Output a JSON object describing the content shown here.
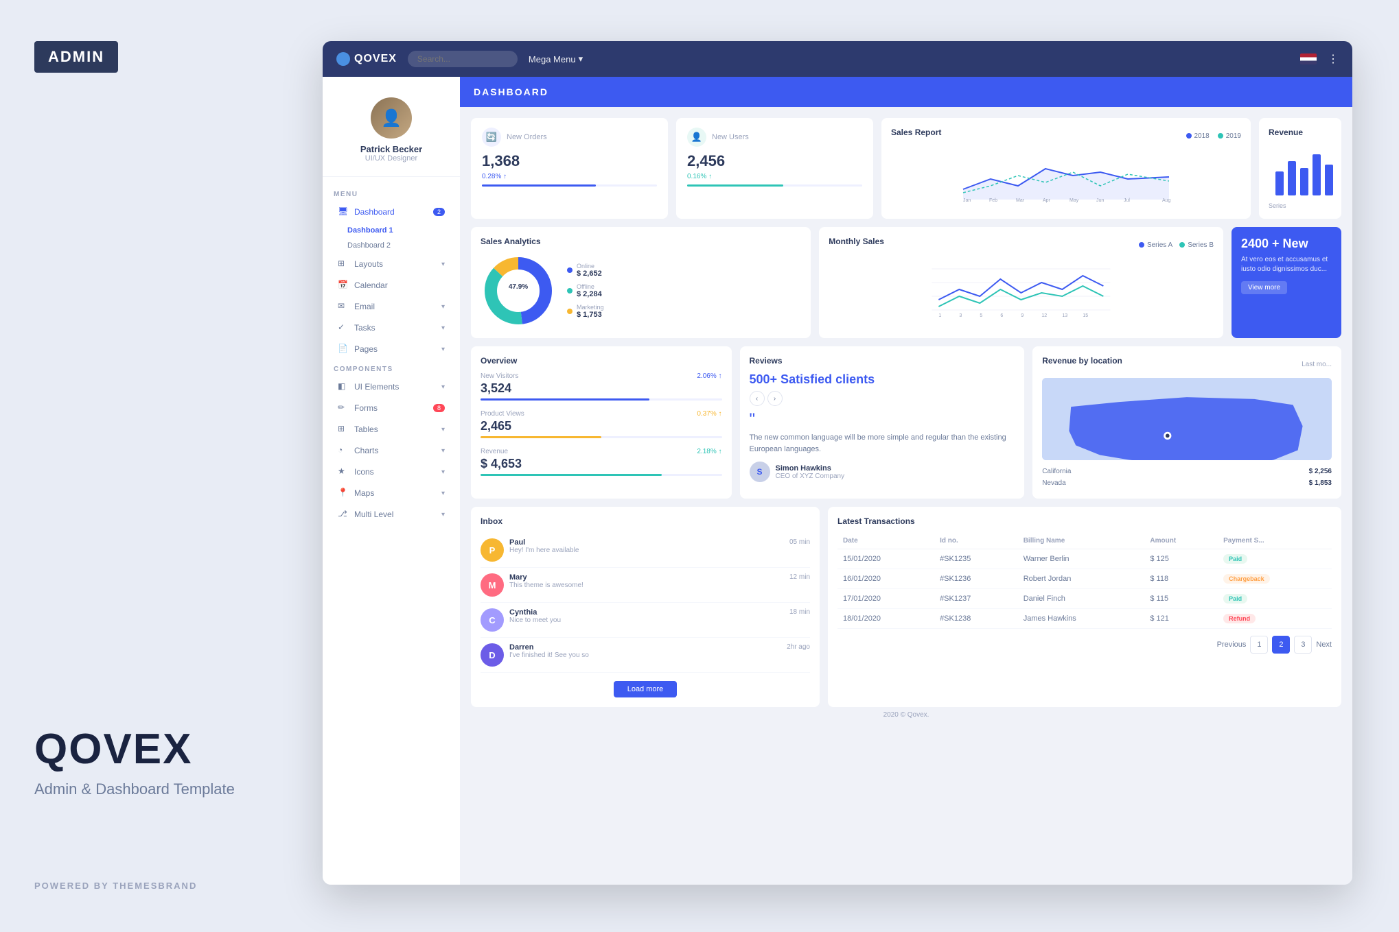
{
  "brand": {
    "admin_badge": "ADMIN",
    "title": "QOVEX",
    "subtitle": "Admin & Dashboard Template",
    "powered_by": "POWERED BY THEMESBRAND"
  },
  "navbar": {
    "logo": "QOVEX",
    "search_placeholder": "Search...",
    "mega_menu": "Mega Menu",
    "flag": "us"
  },
  "sidebar": {
    "profile": {
      "name": "Patrick Becker",
      "role": "UI/UX Designer"
    },
    "menu_label": "MENU",
    "components_label": "COMPONENTS",
    "items": [
      {
        "id": "dashboard",
        "label": "Dashboard",
        "icon": "monitor",
        "badge": "2",
        "active": true
      },
      {
        "id": "dashboard1",
        "label": "Dashboard 1",
        "sub": true
      },
      {
        "id": "dashboard2",
        "label": "Dashboard 2",
        "sub": true
      },
      {
        "id": "layouts",
        "label": "Layouts",
        "icon": "grid",
        "arrow": true
      },
      {
        "id": "calendar",
        "label": "Calendar",
        "icon": "calendar"
      },
      {
        "id": "email",
        "label": "Email",
        "icon": "mail",
        "arrow": true
      },
      {
        "id": "tasks",
        "label": "Tasks",
        "icon": "check",
        "arrow": true
      },
      {
        "id": "pages",
        "label": "Pages",
        "icon": "file",
        "arrow": true
      },
      {
        "id": "ui-elements",
        "label": "UI Elements",
        "icon": "layers",
        "arrow": true
      },
      {
        "id": "forms",
        "label": "Forms",
        "icon": "edit",
        "badge_red": "8"
      },
      {
        "id": "tables",
        "label": "Tables",
        "icon": "table",
        "arrow": true
      },
      {
        "id": "charts",
        "label": "Charts",
        "icon": "pie-chart",
        "arrow": true
      },
      {
        "id": "icons",
        "label": "Icons",
        "icon": "star",
        "arrow": true
      },
      {
        "id": "maps",
        "label": "Maps",
        "icon": "map-pin",
        "arrow": true
      },
      {
        "id": "multi-level",
        "label": "Multi Level",
        "icon": "git-branch",
        "arrow": true
      }
    ]
  },
  "header": {
    "title": "DASHBOARD"
  },
  "stats": [
    {
      "label": "New Orders",
      "value": "1,368",
      "change": "0.28% ↑",
      "bar_width": "65",
      "icon": "🔄",
      "icon_bg": "#eef0ff"
    },
    {
      "label": "New Users",
      "value": "2,456",
      "change": "0.16% ↑",
      "bar_width": "55",
      "bar_color": "#2ec4b6",
      "icon": "👤",
      "icon_bg": "#e8f8f5"
    }
  ],
  "sales_report": {
    "title": "Sales Report",
    "legend": [
      {
        "label": "2018",
        "color": "#3d5af1"
      },
      {
        "label": "2019",
        "color": "#2ec4b6"
      }
    ],
    "x_labels": [
      "Jan",
      "Feb",
      "Mar",
      "Apr",
      "May",
      "Jun",
      "Jul",
      "Aug"
    ]
  },
  "revenue": {
    "title": "Revenue",
    "series_label": "Series"
  },
  "sales_analytics": {
    "title": "Sales Analytics",
    "center_percent": "47.9%",
    "segments": [
      {
        "label": "Online",
        "color": "#3d5af1",
        "value": "$ 2,652",
        "percent": 47.9
      },
      {
        "label": "Offline",
        "color": "#2ec4b6",
        "value": "$ 2,284",
        "percent": 38.7
      },
      {
        "label": "Marketing",
        "color": "#f7b731",
        "value": "$ 1,753",
        "percent": 13.4
      }
    ]
  },
  "monthly_sales": {
    "title": "Monthly Sales",
    "legend": [
      {
        "label": "Series A",
        "color": "#3d5af1"
      },
      {
        "label": "Series B",
        "color": "#2ec4b6"
      }
    ]
  },
  "promo": {
    "title": "2400 + New",
    "text": "At vero eos et accusamus et iusto odio dignissimos duc...",
    "btn_label": "View more"
  },
  "overview": {
    "title": "Overview",
    "items": [
      {
        "label": "New Visitors",
        "value": "3,524",
        "change": "2.06% ↑",
        "bar": 70,
        "bar_color": "#3d5af1"
      },
      {
        "label": "Product Views",
        "value": "2,465",
        "change": "0.37% ↑",
        "bar": 50,
        "bar_color": "#f7b731"
      },
      {
        "label": "Revenue",
        "value": "$ 4,653",
        "change": "2.18% ↑",
        "bar": 75,
        "bar_color": "#2ec4b6"
      }
    ]
  },
  "reviews": {
    "title": "Reviews",
    "count": "500+ Satisfied clients",
    "text": "The new common language will be more simple and regular than the existing European languages.",
    "reviewer": {
      "name": "Simon Hawkins",
      "role": "CEO of XYZ Company",
      "initial": "S"
    }
  },
  "revenue_location": {
    "title": "Revenue by location",
    "last_more": "Last mo...",
    "locations": [
      {
        "name": "California",
        "value": "$ 2,256"
      },
      {
        "name": "Nevada",
        "value": "$ 1,853"
      }
    ]
  },
  "inbox": {
    "title": "Inbox",
    "messages": [
      {
        "name": "Paul",
        "msg": "Hey! I'm here available",
        "time": "05 min",
        "color": "#f7b731"
      },
      {
        "name": "Mary",
        "msg": "This theme is awesome!",
        "time": "12 min",
        "color": "#ff6b81"
      },
      {
        "name": "Cynthia",
        "msg": "Nice to meet you",
        "time": "18 min",
        "color": "#a29bfe"
      },
      {
        "name": "Darren",
        "msg": "I've finished it! See you so",
        "time": "2hr ago",
        "color": "#6c5ce7"
      }
    ],
    "load_more_label": "Load more"
  },
  "transactions": {
    "title": "Latest Transactions",
    "columns": [
      "Date",
      "Id no.",
      "Billing Name",
      "Amount",
      "Payment S..."
    ],
    "rows": [
      {
        "date": "15/01/2020",
        "id": "#SK1235",
        "name": "Warner Berlin",
        "amount": "$ 125",
        "status": "Paid",
        "status_type": "paid"
      },
      {
        "date": "16/01/2020",
        "id": "#SK1236",
        "name": "Robert Jordan",
        "amount": "$ 118",
        "status": "Chargeback",
        "status_type": "chargeback"
      },
      {
        "date": "17/01/2020",
        "id": "#SK1237",
        "name": "Daniel Finch",
        "amount": "$ 115",
        "status": "Paid",
        "status_type": "paid"
      },
      {
        "date": "18/01/2020",
        "id": "#SK1238",
        "name": "James Hawkins",
        "amount": "$ 121",
        "status": "Refund",
        "status_type": "refund"
      }
    ],
    "pagination": {
      "prev": "Previous",
      "pages": [
        "1",
        "2",
        "3"
      ],
      "active_page": "2",
      "next": "Next"
    }
  },
  "footer": {
    "text": "2020 © Qovex."
  }
}
